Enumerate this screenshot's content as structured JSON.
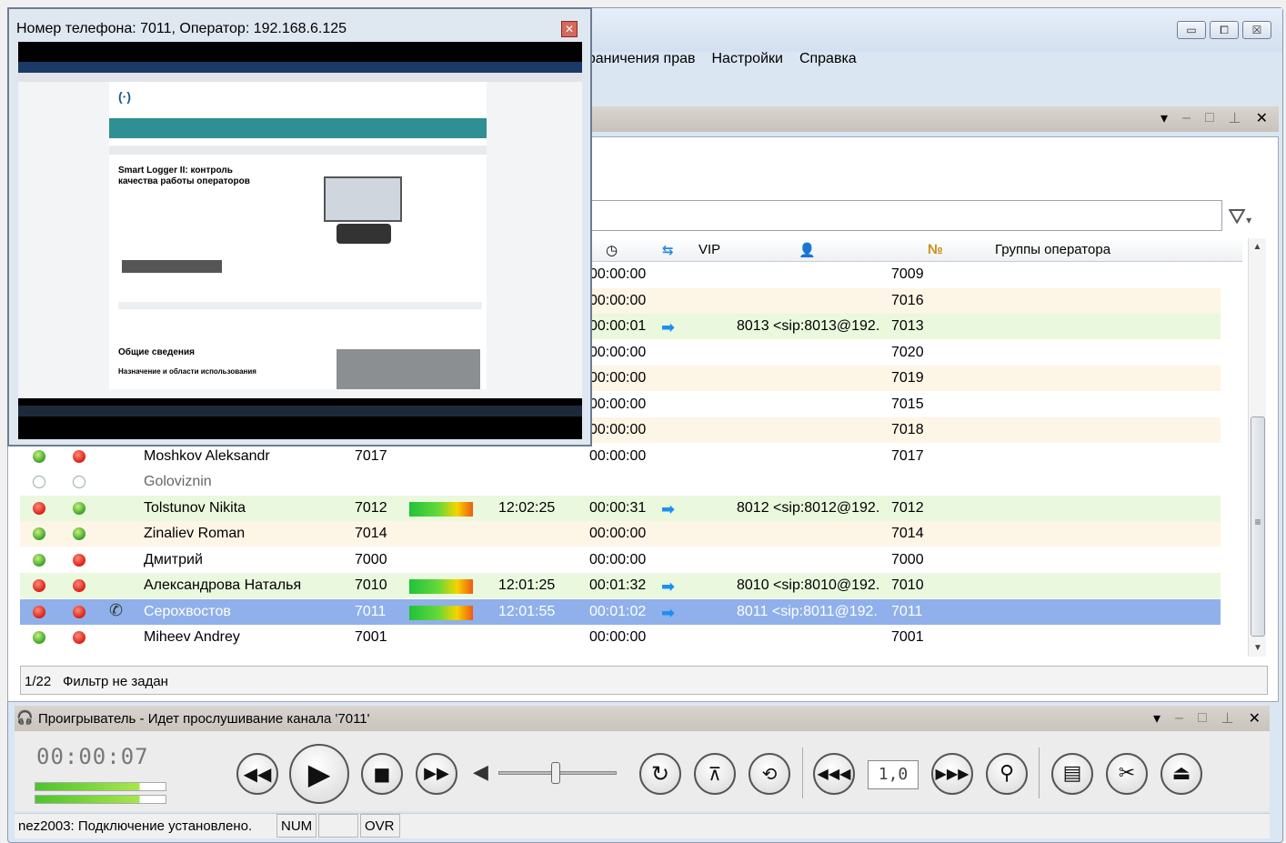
{
  "app": {
    "menu": [
      "граничения прав",
      "Настройки",
      "Справка"
    ],
    "window_buttons": [
      "▭",
      "⧠",
      "☒"
    ]
  },
  "pane": {
    "controls": [
      "▾",
      "–",
      "□",
      "⊥",
      "✕"
    ]
  },
  "grid": {
    "headers": {
      "vip": "VIP",
      "groups": "Группы оператора"
    },
    "rows": [
      {
        "dur": "00:00:00",
        "ext2": "7009"
      },
      {
        "dur": "00:00:00",
        "ext2": "7016"
      },
      {
        "dur": "00:00:01",
        "arrow": "➡",
        "sip": "8013 <sip:8013@192.",
        "ext2": "7013"
      },
      {
        "dur": "00:00:00",
        "ext2": "7020"
      },
      {
        "dur": "00:00:00",
        "ext2": "7019"
      },
      {
        "dur": "00:00:00",
        "ext2": "7015"
      },
      {
        "dur": "00:00:00",
        "ext2": "7018"
      },
      {
        "name": "Moshkov Aleksandr",
        "ext": "7017",
        "dur": "00:00:00",
        "ext2": "7017"
      },
      {
        "name": "Goloviznin"
      },
      {
        "name": "Tolstunov Nikita",
        "ext": "7012",
        "time": "12:02:25",
        "dur": "00:00:31",
        "arrow": "➡",
        "sip": "8012 <sip:8012@192.",
        "ext2": "7012"
      },
      {
        "name": "Zinaliev Roman",
        "ext": "7014",
        "dur": "00:00:00",
        "ext2": "7014"
      },
      {
        "name": "Дмитрий",
        "ext": "7000",
        "dur": "00:00:00",
        "ext2": "7000"
      },
      {
        "name": "Александрова Наталья",
        "ext": "7010",
        "time": "12:01:25",
        "dur": "00:01:32",
        "arrow": "➡",
        "sip": "8010 <sip:8010@192.",
        "ext2": "7010"
      },
      {
        "name": "Серохвостов",
        "ext": "7011",
        "time": "12:01:55",
        "dur": "00:01:02",
        "arrow": "➡",
        "sip": "8011 <sip:8011@192.",
        "ext2": "7011"
      },
      {
        "name": "Miheev Andrey",
        "ext": "7001",
        "dur": "00:00:00",
        "ext2": "7001"
      }
    ],
    "status": {
      "count": "1/22",
      "filter": "Фильтр не задан"
    }
  },
  "player": {
    "title": "Проигрыватель - Идет прослушивание канала '7011'",
    "time": "00:00:07",
    "speed": "1,0"
  },
  "statusbar": {
    "text": "nez2003: Подключение установлено.",
    "num": "NUM",
    "ovr": "OVR"
  },
  "popup": {
    "title": "Номер телефона: 7011, Оператор: 192.168.6.125",
    "close": "✕",
    "page_heading": "Smart Logger II: контроль качества работы операторов",
    "section": "Общие сведения",
    "subsection": "Назначение и области использования"
  }
}
